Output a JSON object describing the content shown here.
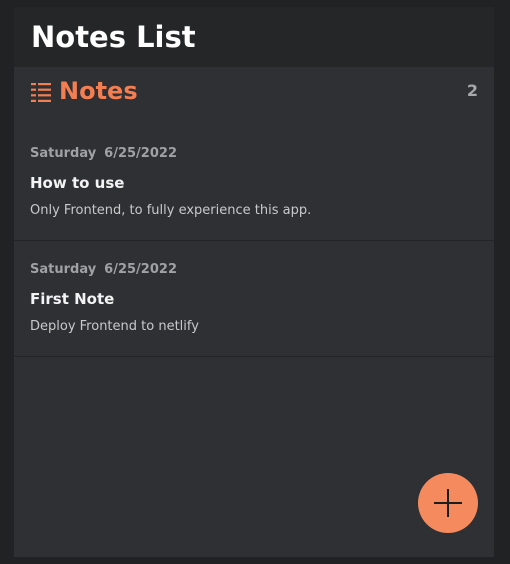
{
  "header": {
    "title": "Notes List"
  },
  "notes_section": {
    "icon": "list-icon",
    "heading": "Notes",
    "count": "2"
  },
  "notes": [
    {
      "day": "Saturday",
      "date": "6/25/2022",
      "title": "How to use",
      "body": "Only Frontend, to fully experience this app."
    },
    {
      "day": "Saturday",
      "date": "6/25/2022",
      "title": "First Note",
      "body": "Deploy Frontend to netlify"
    }
  ],
  "add_button": {
    "icon": "plus-icon"
  },
  "colors": {
    "page_background": "#212224",
    "panel_background": "#2e3033",
    "header_background": "#252628",
    "accent": "#f27e52",
    "fab": "#f58a5e"
  }
}
